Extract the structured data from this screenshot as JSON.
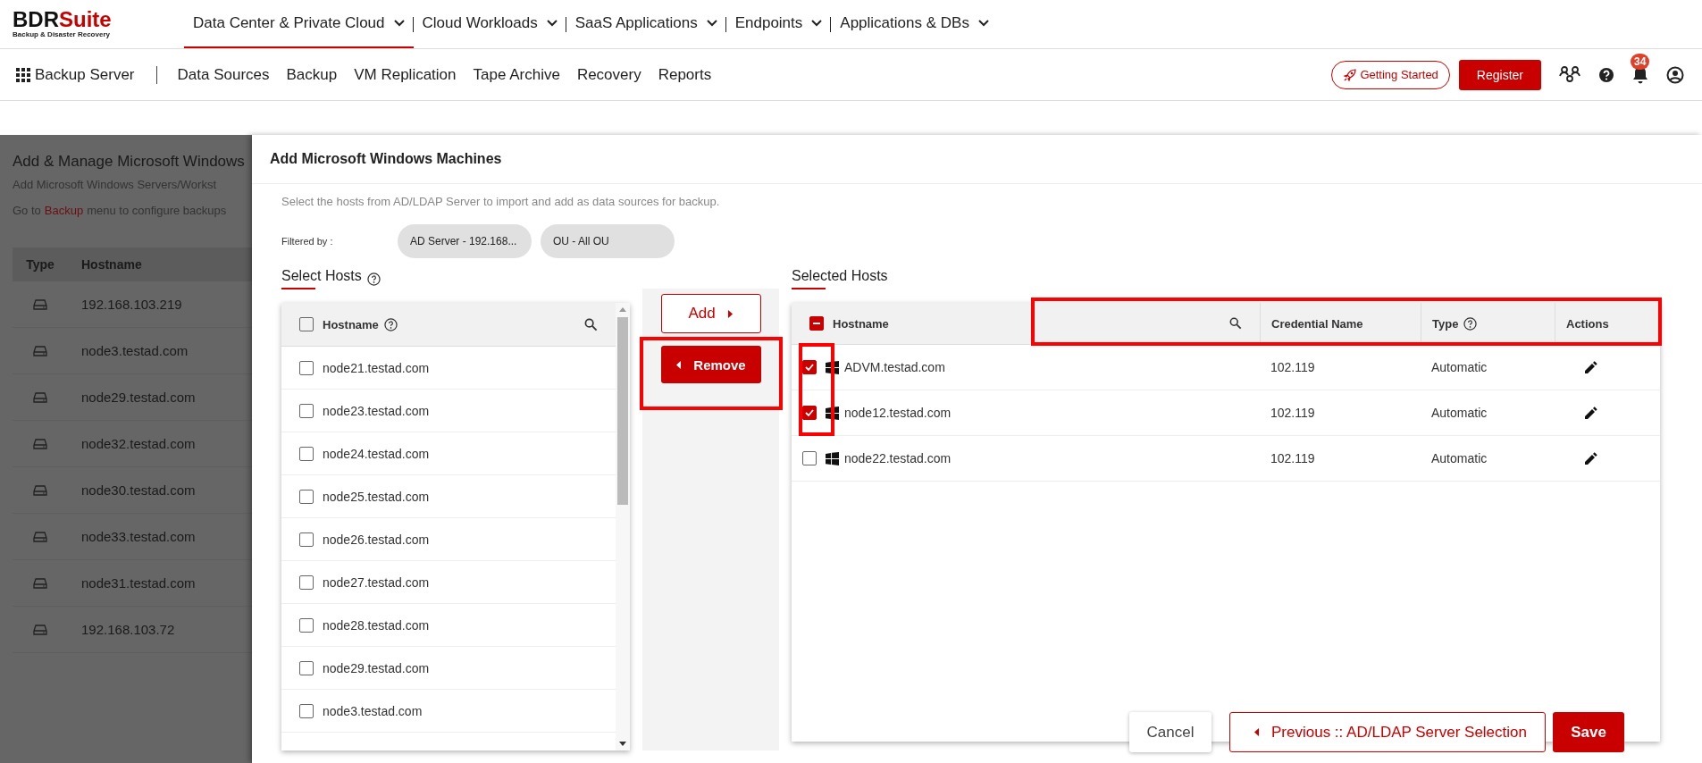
{
  "brand": {
    "name_a": "BDR",
    "name_b": "Suite",
    "tagline": "Backup & Disaster Recovery"
  },
  "top_nav": [
    {
      "label": "Data Center & Private Cloud",
      "selected": true
    },
    {
      "label": "Cloud Workloads",
      "selected": false
    },
    {
      "label": "SaaS Applications",
      "selected": false
    },
    {
      "label": "Endpoints",
      "selected": false
    },
    {
      "label": "Applications & DBs",
      "selected": false
    }
  ],
  "app_bar": {
    "app_name": "Backup Server",
    "items": [
      "Data Sources",
      "Backup",
      "VM Replication",
      "Tape Archive",
      "Recovery",
      "Reports"
    ],
    "getting_started": "Getting Started",
    "register": "Register",
    "notification_count": "34"
  },
  "background_page": {
    "title": "Add & Manage Microsoft Windows",
    "subtitle": "Add Microsoft Windows Servers/Workst",
    "hint_prefix": "Go to",
    "hint_link": "Backup",
    "hint_suffix": "menu to configure backups",
    "columns": [
      "Type",
      "Hostname"
    ],
    "rows": [
      "192.168.103.219",
      "node3.testad.com",
      "node29.testad.com",
      "node32.testad.com",
      "node30.testad.com",
      "node33.testad.com",
      "node31.testad.com",
      "192.168.103.72"
    ]
  },
  "modal": {
    "title": "Add Microsoft Windows Machines",
    "description": "Select the hosts from AD/LDAP Server to import and add as data sources for backup.",
    "filter_label": "Filtered by :",
    "filters": [
      "AD Server - 192.168...",
      "OU - All OU"
    ],
    "select_hosts": {
      "title": "Select Hosts",
      "column": "Hostname",
      "header_checked": false,
      "rows": [
        {
          "hostname": "node21.testad.com",
          "checked": false
        },
        {
          "hostname": "node23.testad.com",
          "checked": false
        },
        {
          "hostname": "node24.testad.com",
          "checked": false
        },
        {
          "hostname": "node25.testad.com",
          "checked": false
        },
        {
          "hostname": "node26.testad.com",
          "checked": false
        },
        {
          "hostname": "node27.testad.com",
          "checked": false
        },
        {
          "hostname": "node28.testad.com",
          "checked": false
        },
        {
          "hostname": "node29.testad.com",
          "checked": false
        },
        {
          "hostname": "node3.testad.com",
          "checked": false
        }
      ]
    },
    "add_button": "Add",
    "remove_button": "Remove",
    "selected_hosts": {
      "title": "Selected Hosts",
      "header_partial": true,
      "columns": [
        "Hostname",
        "Credential Name",
        "Type",
        "Actions"
      ],
      "rows": [
        {
          "hostname": "ADVM.testad.com",
          "credential": "102.119",
          "type": "Automatic",
          "checked": true
        },
        {
          "hostname": "node12.testad.com",
          "credential": "102.119",
          "type": "Automatic",
          "checked": true
        },
        {
          "hostname": "node22.testad.com",
          "credential": "102.119",
          "type": "Automatic",
          "checked": false
        }
      ]
    },
    "cancel_button": "Cancel",
    "previous_button": "Previous :: AD/LDAP Server Selection",
    "save_button": "Save"
  }
}
